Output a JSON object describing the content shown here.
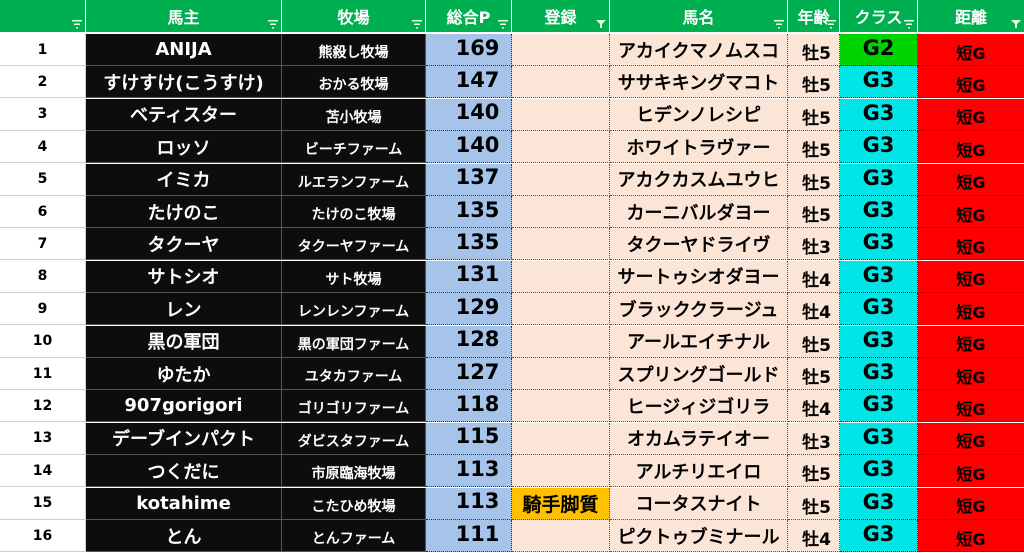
{
  "headers": [
    "",
    "馬主",
    "牧場",
    "総合P",
    "登録",
    "馬名",
    "年齢",
    "クラス",
    "距離"
  ],
  "header_filters": [
    "sort",
    "sort",
    "sort",
    "sort",
    "filter",
    "sort",
    "sort",
    "sort",
    "filter"
  ],
  "rows": [
    {
      "num": "1",
      "owner": "ANIJA",
      "farm": "熊殺し牧場",
      "points": "169",
      "reg": "",
      "horse": "アカイクマノムスコ",
      "age": "牡5",
      "cls": "G2",
      "dist": "短G"
    },
    {
      "num": "2",
      "owner": "すけすけ(こうすけ)",
      "farm": "おかる牧場",
      "points": "147",
      "reg": "",
      "horse": "ササキキングマコト",
      "age": "牡5",
      "cls": "G3",
      "dist": "短G"
    },
    {
      "num": "3",
      "owner": "ベティスター",
      "farm": "苫小牧場",
      "points": "140",
      "reg": "",
      "horse": "ヒデンノレシピ",
      "age": "牡5",
      "cls": "G3",
      "dist": "短G"
    },
    {
      "num": "4",
      "owner": "ロッソ",
      "farm": "ビーチファーム",
      "points": "140",
      "reg": "",
      "horse": "ホワイトラヴァー",
      "age": "牡5",
      "cls": "G3",
      "dist": "短G"
    },
    {
      "num": "5",
      "owner": "イミカ",
      "farm": "ルエランファーム",
      "points": "137",
      "reg": "",
      "horse": "アカクカスムユウヒ",
      "age": "牡5",
      "cls": "G3",
      "dist": "短G"
    },
    {
      "num": "6",
      "owner": "たけのこ",
      "farm": "たけのこ牧場",
      "points": "135",
      "reg": "",
      "horse": "カーニバルダヨー",
      "age": "牡5",
      "cls": "G3",
      "dist": "短G"
    },
    {
      "num": "7",
      "owner": "タクーヤ",
      "farm": "タクーヤファーム",
      "points": "135",
      "reg": "",
      "horse": "タクーヤドライヴ",
      "age": "牡3",
      "cls": "G3",
      "dist": "短G"
    },
    {
      "num": "8",
      "owner": "サトシオ",
      "farm": "サト牧場",
      "points": "131",
      "reg": "",
      "horse": "サートゥシオダヨー",
      "age": "牡4",
      "cls": "G3",
      "dist": "短G"
    },
    {
      "num": "9",
      "owner": "レン",
      "farm": "レンレンファーム",
      "points": "129",
      "reg": "",
      "horse": "ブラッククラージュ",
      "age": "牡4",
      "cls": "G3",
      "dist": "短G"
    },
    {
      "num": "10",
      "owner": "黒の軍団",
      "farm": "黒の軍団ファーム",
      "points": "128",
      "reg": "",
      "horse": "アールエイチナル",
      "age": "牡5",
      "cls": "G3",
      "dist": "短G"
    },
    {
      "num": "11",
      "owner": "ゆたか",
      "farm": "ユタカファーム",
      "points": "127",
      "reg": "",
      "horse": "スプリングゴールド",
      "age": "牡5",
      "cls": "G3",
      "dist": "短G"
    },
    {
      "num": "12",
      "owner": "907gorigori",
      "farm": "ゴリゴリファーム",
      "points": "118",
      "reg": "",
      "horse": "ヒージィジゴリラ",
      "age": "牡4",
      "cls": "G3",
      "dist": "短G"
    },
    {
      "num": "13",
      "owner": "デーブインパクト",
      "farm": "ダビスタファーム",
      "points": "115",
      "reg": "",
      "horse": "オカムラテイオー",
      "age": "牡3",
      "cls": "G3",
      "dist": "短G"
    },
    {
      "num": "14",
      "owner": "つくだに",
      "farm": "市原臨海牧場",
      "points": "113",
      "reg": "",
      "horse": "アルチリエイロ",
      "age": "牡5",
      "cls": "G3",
      "dist": "短G"
    },
    {
      "num": "15",
      "owner": "kotahime",
      "farm": "こたひめ牧場",
      "points": "113",
      "reg": "騎手脚質",
      "horse": "コータスナイト",
      "age": "牡5",
      "cls": "G3",
      "dist": "短G"
    },
    {
      "num": "16",
      "owner": "とん",
      "farm": "とんファーム",
      "points": "111",
      "reg": "",
      "horse": "ピクトゥブミナール",
      "age": "牡4",
      "cls": "G3",
      "dist": "短G"
    }
  ],
  "colors": {
    "header_bg": "#00b050",
    "owner_bg": "#0d0d0d",
    "points_bg": "#a6c3ea",
    "entry_bg": "#fbe5d6",
    "reg_highlight": "#ffc000",
    "class_g3": "#00e6e6",
    "class_g2": "#00d400",
    "distance_bg": "#ff0000"
  }
}
